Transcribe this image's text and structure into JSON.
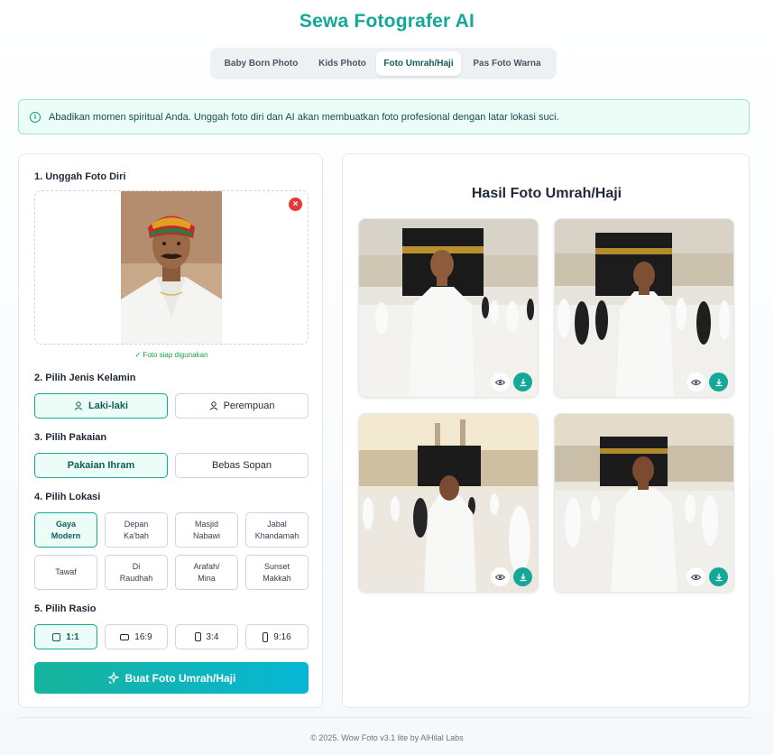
{
  "app_title": "Sewa Fotografer AI",
  "tabs": [
    "Baby Born Photo",
    "Kids Photo",
    "Foto Umrah/Haji",
    "Pas Foto Warna"
  ],
  "info_text": "Abadikan momen spiritual Anda. Unggah foto diri dan AI akan membuatkan foto profesional dengan latar lokasi suci.",
  "steps": {
    "upload": "1. Unggah Foto Diri",
    "gender": "2. Pilih Jenis Kelamin",
    "outfit": "3. Pilih Pakaian",
    "location": "4. Pilih Lokasi",
    "ratio": "5. Pilih Rasio"
  },
  "upload_status": "✓ Foto siap digunakan",
  "gender": {
    "male": "Laki-laki",
    "female": "Perempuan"
  },
  "outfit": {
    "ihram": "Pakaian Ihram",
    "free": "Bebas Sopan"
  },
  "locations": [
    {
      "line1": "Gaya",
      "line2": "Modern"
    },
    {
      "line1": "Depan",
      "line2": "Ka'bah"
    },
    {
      "line1": "Masjid",
      "line2": "Nabawi"
    },
    {
      "line1": "Jabal",
      "line2": "Khandamah"
    },
    {
      "line1": "Tawaf",
      "line2": ""
    },
    {
      "line1": "Di",
      "line2": "Raudhah"
    },
    {
      "line1": "Arafah/",
      "line2": "Mina"
    },
    {
      "line1": "Sunset",
      "line2": "Makkah"
    }
  ],
  "ratios": [
    "1:1",
    "16:9",
    "3:4",
    "9:16"
  ],
  "create_button": "Buat Foto Umrah/Haji",
  "results_title": "Hasil Foto Umrah/Haji",
  "footer": "© 2025. Wow Foto v3.1 lite by AlHilal Labs",
  "colors": {
    "accent": "#14a899",
    "accent_light": "#ecfdf7",
    "danger": "#e53935"
  },
  "icons": [
    "info-icon",
    "remove-icon",
    "user-icon",
    "sparkle-icon",
    "eye-icon",
    "download-icon"
  ]
}
